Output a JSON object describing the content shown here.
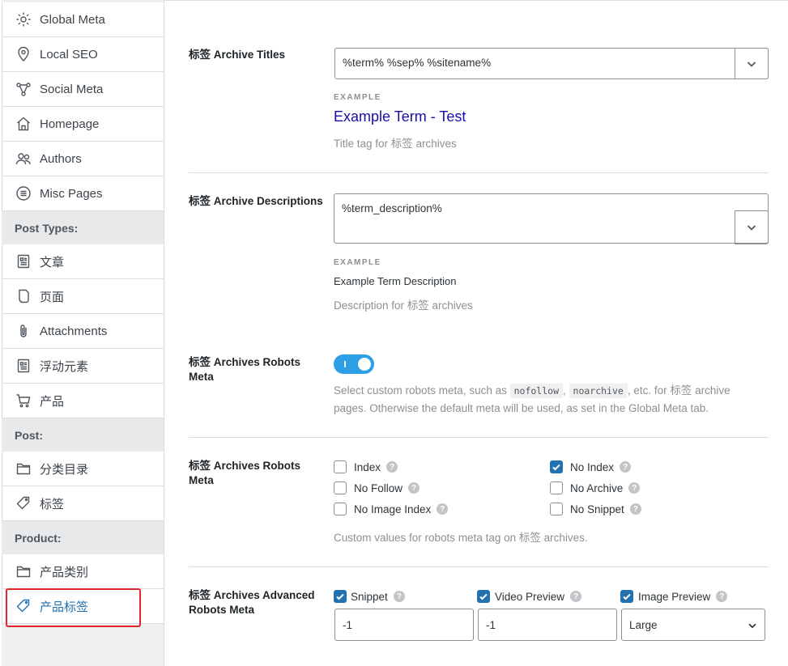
{
  "sidebar": {
    "items": [
      {
        "label": "Global Meta",
        "icon": "gear-icon"
      },
      {
        "label": "Local SEO",
        "icon": "location-pin-icon"
      },
      {
        "label": "Social Meta",
        "icon": "share-icon"
      },
      {
        "label": "Homepage",
        "icon": "home-icon"
      },
      {
        "label": "Authors",
        "icon": "users-icon"
      },
      {
        "label": "Misc Pages",
        "icon": "list-circle-icon"
      }
    ],
    "post_types_header": "Post Types:",
    "post_types": [
      {
        "label": "文章",
        "icon": "document-icon"
      },
      {
        "label": "页面",
        "icon": "page-icon"
      },
      {
        "label": "Attachments",
        "icon": "paperclip-icon"
      },
      {
        "label": "浮动元素",
        "icon": "document-icon"
      },
      {
        "label": "产品",
        "icon": "cart-icon"
      }
    ],
    "post_header": "Post:",
    "post_items": [
      {
        "label": "分类目录",
        "icon": "folder-icon"
      },
      {
        "label": "标签",
        "icon": "tag-icon"
      }
    ],
    "product_header": "Product:",
    "product_items": [
      {
        "label": "产品类别",
        "icon": "folder-icon"
      },
      {
        "label": "产品标签",
        "icon": "tag-icon"
      }
    ]
  },
  "main": {
    "archive_titles": {
      "label": "标签 Archive Titles",
      "value": "%term% %sep% %sitename%",
      "example_label": "EXAMPLE",
      "example_value": "Example Term - Test",
      "help": "Title tag for 标签 archives"
    },
    "archive_descriptions": {
      "label": "标签 Archive Descriptions",
      "value": "%term_description%",
      "example_label": "EXAMPLE",
      "example_value": "Example Term Description",
      "help": "Description for 标签 archives"
    },
    "robots_meta_toggle": {
      "label_line1": "标签 Archives Robots",
      "label_line2": "Meta",
      "enabled": true,
      "help_1": "Select custom robots meta, such as ",
      "code_1": "nofollow",
      "help_2": ", ",
      "code_2": "noarchive",
      "help_3": ", etc. for 标签 archive",
      "help_4": "pages. Otherwise the default meta will be used, as set in the Global Meta tab."
    },
    "robots_meta": {
      "label_line1": "标签 Archives Robots",
      "label_line2": "Meta",
      "options": [
        {
          "label": "Index",
          "checked": false
        },
        {
          "label": "No Follow",
          "checked": false
        },
        {
          "label": "No Image Index",
          "checked": false
        },
        {
          "label": "No Index",
          "checked": true
        },
        {
          "label": "No Archive",
          "checked": false
        },
        {
          "label": "No Snippet",
          "checked": false
        }
      ],
      "help": "Custom values for robots meta tag on 标签 archives."
    },
    "advanced_robots": {
      "label_line1": "标签 Archives Advanced",
      "label_line2": "Robots Meta",
      "snippet_label": "Snippet",
      "snippet_value": "-1",
      "video_label": "Video Preview",
      "video_value": "-1",
      "image_label": "Image Preview",
      "image_value": "Large"
    },
    "help_mark": "?"
  }
}
